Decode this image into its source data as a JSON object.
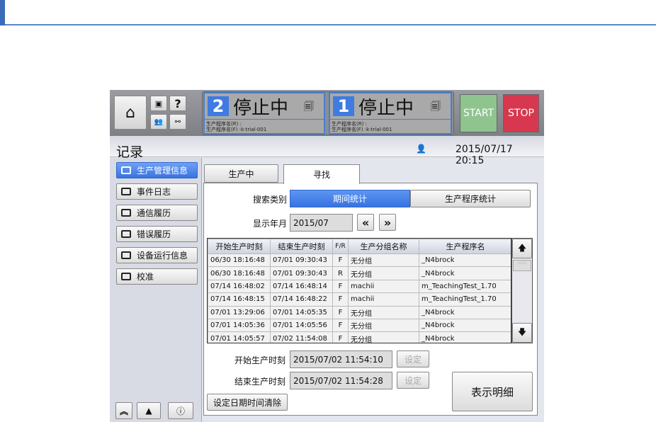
{
  "header": {
    "stations": [
      {
        "num": "2",
        "status": "停止中",
        "prog_r": "生产程序名(R) :",
        "prog_f": "生产程序名(F) :k-trial-001"
      },
      {
        "num": "1",
        "status": "停止中",
        "prog_r": "生产程序名(R) :",
        "prog_f": "生产程序名(F) :k-trial-001"
      }
    ],
    "start": "START",
    "stop": "STOP",
    "help": "?"
  },
  "title": "记录",
  "datetime": "2015/07/17 20:15",
  "sidebar": [
    "生产管理信息",
    "事件日志",
    "通信履历",
    "错误履历",
    "设备运行信息",
    "校准"
  ],
  "tabs": [
    "生产中",
    "寻找"
  ],
  "search": {
    "label": "搜索类别",
    "opt1": "期间统计",
    "opt2": "生产程序统计",
    "month_label": "显示年月",
    "month": "2015/07",
    "prev": "«",
    "next": "»"
  },
  "table": {
    "headers": [
      "开始生产时刻",
      "结束生产时刻",
      "F/R",
      "生产分组名称",
      "生产程序名"
    ],
    "rows": [
      [
        "06/30 18:16:48",
        "07/01 09:30:43",
        "F",
        "无分组",
        "_N4brock"
      ],
      [
        "06/30 18:16:48",
        "07/01 09:30:43",
        "R",
        "无分组",
        "_N4brock"
      ],
      [
        "07/14 16:48:02",
        "07/14 16:48:14",
        "F",
        "machii",
        "m_TeachingTest_1.70"
      ],
      [
        "07/14 16:48:15",
        "07/14 16:48:22",
        "F",
        "machii",
        "m_TeachingTest_1.70"
      ],
      [
        "07/01 13:29:06",
        "07/01 14:05:35",
        "F",
        "无分组",
        "_N4brock"
      ],
      [
        "07/01 14:05:36",
        "07/01 14:05:56",
        "F",
        "无分组",
        "_N4brock"
      ],
      [
        "07/01 14:05:57",
        "07/02 11:54:08",
        "F",
        "无分组",
        "_N4brock"
      ]
    ]
  },
  "form": {
    "start_label": "开始生产时刻",
    "start": "2015/07/02 11:54:10",
    "end_label": "结束生产时刻",
    "end": "2015/07/02 11:54:28",
    "set": "设定",
    "clear": "设定日期时间清除",
    "detail": "表示明细"
  }
}
